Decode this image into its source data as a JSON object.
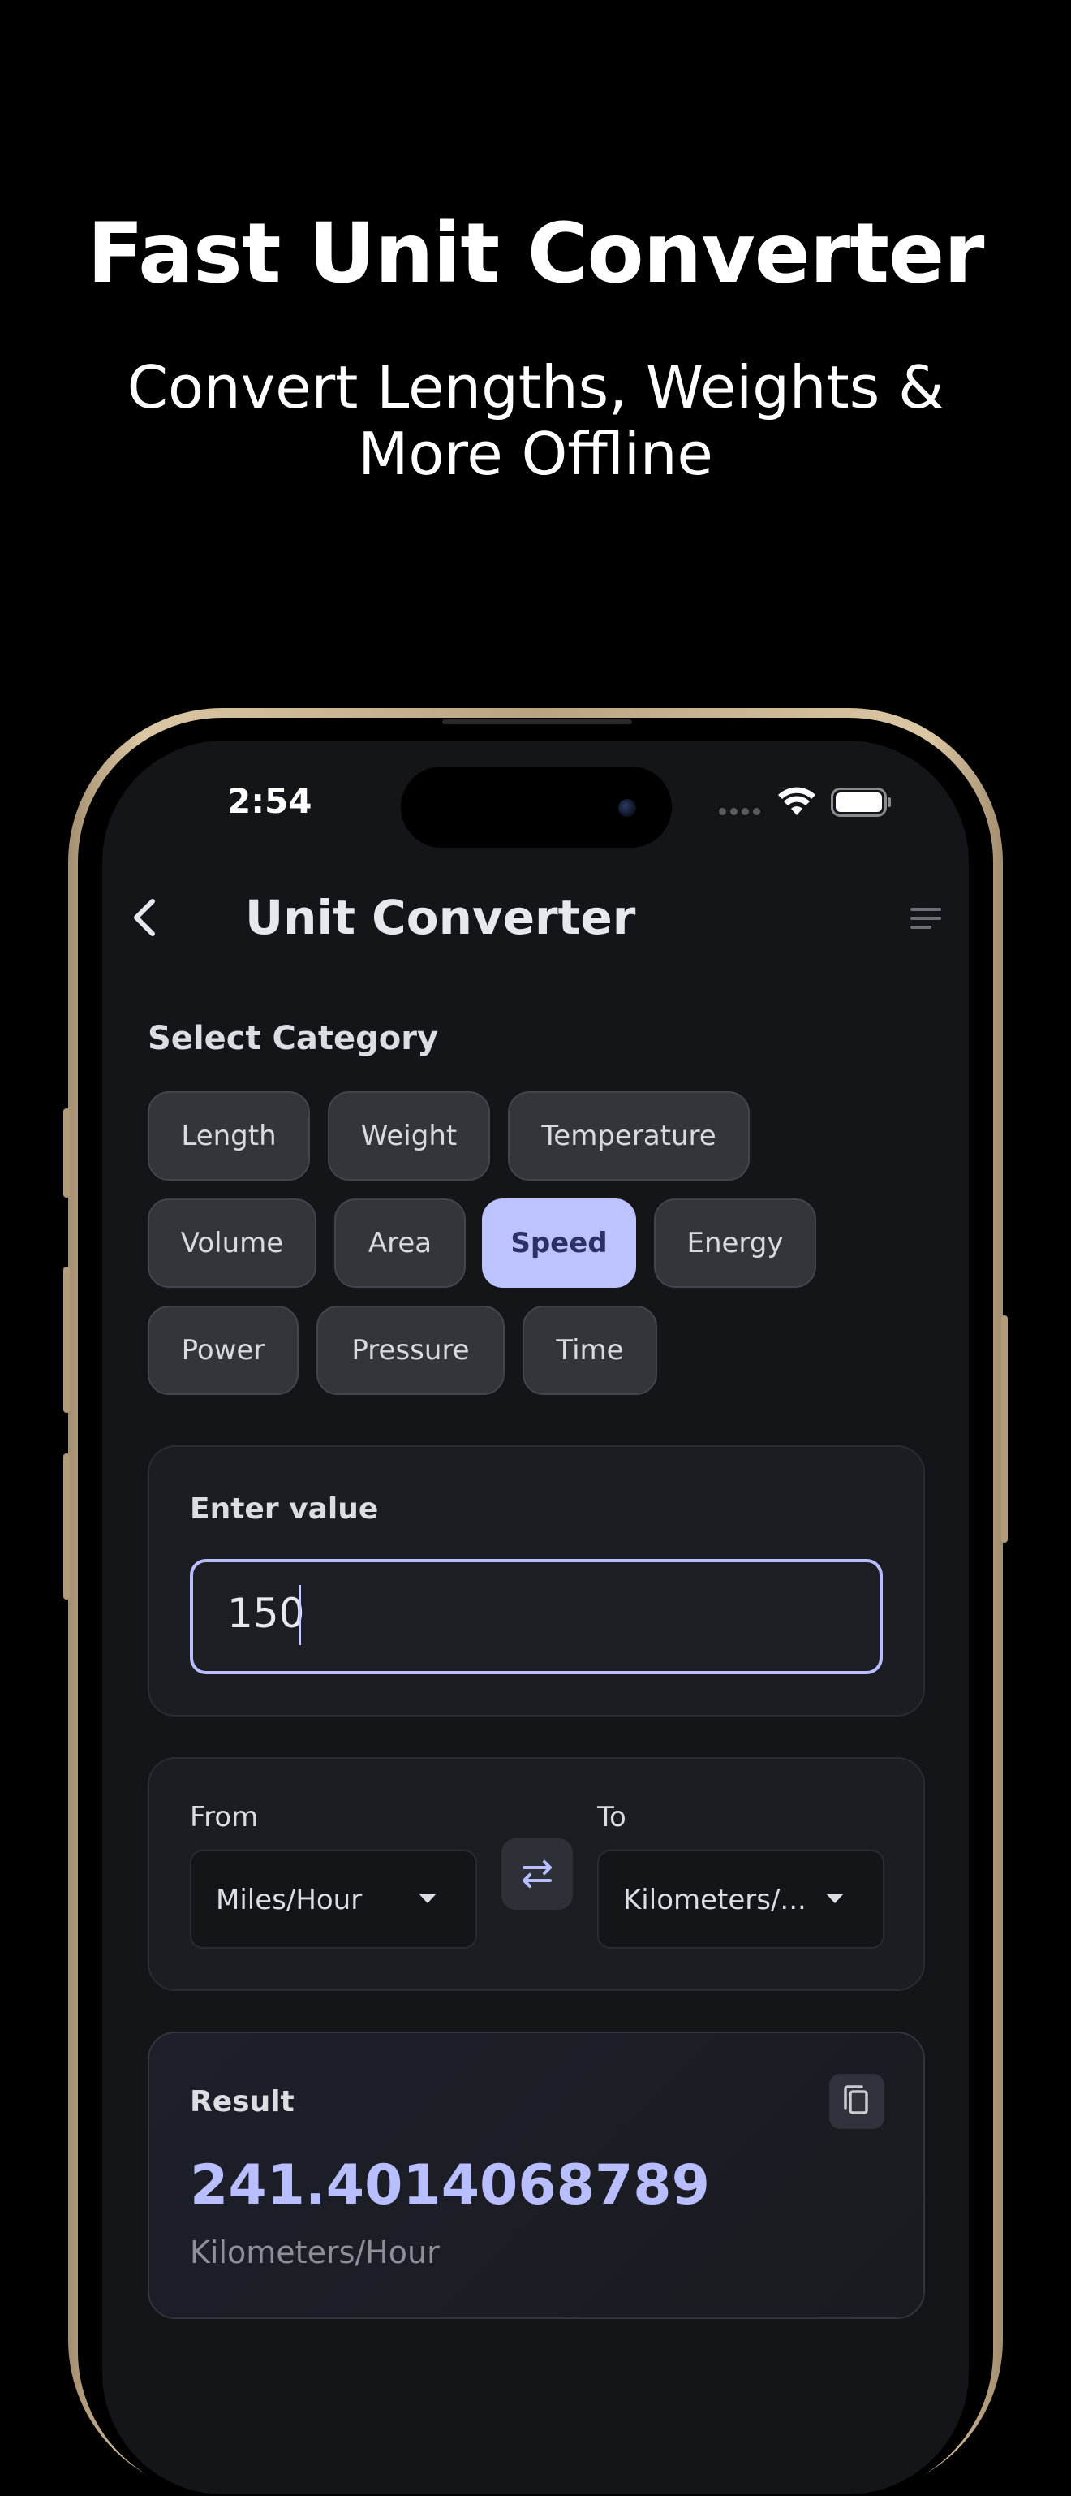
{
  "promo": {
    "title": "Fast Unit Converter",
    "subtitle": "Convert Lengths, Weights & More Offline"
  },
  "status_bar": {
    "time": "2:54"
  },
  "app_bar": {
    "title": "Unit Converter",
    "back_icon": "chevron-left-icon",
    "menu_icon": "sort-lines-icon"
  },
  "category": {
    "label": "Select Category",
    "selected": "Speed",
    "chips": [
      "Length",
      "Weight",
      "Temperature",
      "Volume",
      "Area",
      "Speed",
      "Energy",
      "Power",
      "Pressure",
      "Time"
    ]
  },
  "input": {
    "label": "Enter value",
    "value": "150"
  },
  "conversion": {
    "from_label": "From",
    "to_label": "To",
    "from_unit": "Miles/Hour",
    "to_unit": "Kilometers/...",
    "swap_icon": "swap-arrows-icon"
  },
  "result": {
    "label": "Result",
    "value": "241.4014068789",
    "unit": "Kilometers/Hour",
    "copy_icon": "copy-icon"
  },
  "colors": {
    "accent": "#bcc3ff",
    "background": "#000000",
    "screen": "#141519",
    "card": "#1c1d22",
    "chip": "#34353b"
  }
}
